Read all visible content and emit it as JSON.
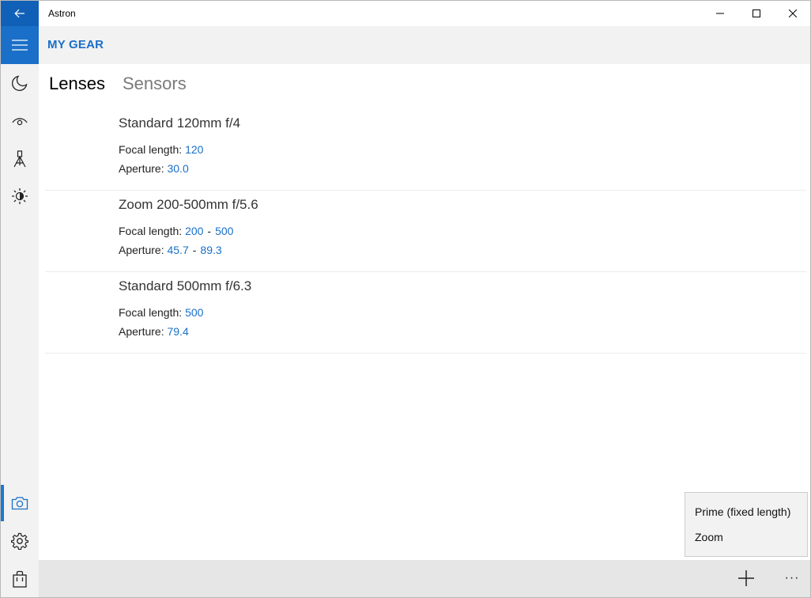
{
  "window": {
    "title": "Astron",
    "controls": {
      "minimize": "minimize-icon",
      "maximize": "maximize-icon",
      "close": "close-icon"
    },
    "back_icon": "back-arrow-icon"
  },
  "header": {
    "title": "MY GEAR"
  },
  "rail": {
    "items": [
      {
        "name": "moon-icon"
      },
      {
        "name": "eye-icon"
      },
      {
        "name": "telescope-icon"
      },
      {
        "name": "sun-icon"
      },
      {
        "name": "camera-icon",
        "active": true
      },
      {
        "name": "gear-icon"
      },
      {
        "name": "shopping-bag-icon"
      }
    ]
  },
  "tabs": [
    {
      "label": "Lenses",
      "selected": true
    },
    {
      "label": "Sensors",
      "selected": false
    }
  ],
  "lenses": [
    {
      "name": "Standard 120mm f/4",
      "focal_label": "Focal length:",
      "focal": [
        "120"
      ],
      "aperture_label": "Aperture:",
      "aperture": [
        "30.0"
      ]
    },
    {
      "name": "Zoom 200-500mm f/5.6",
      "focal_label": "Focal length:",
      "focal": [
        "200",
        "500"
      ],
      "focal_sep": "-",
      "aperture_label": "Aperture:",
      "aperture": [
        "45.7",
        "89.3"
      ],
      "aperture_sep": "-"
    },
    {
      "name": "Standard 500mm f/6.3",
      "focal_label": "Focal length:",
      "focal": [
        "500"
      ],
      "aperture_label": "Aperture:",
      "aperture": [
        "79.4"
      ]
    }
  ],
  "popup_menu": {
    "items": [
      "Prime (fixed length)",
      "Zoom"
    ]
  },
  "bottombar": {
    "add_icon": "plus-icon",
    "more_label": "···"
  },
  "colors": {
    "accent": "#1a6fc8",
    "back_button": "#1160b8",
    "rail_bg": "#f2f2f2",
    "bottombar_bg": "#e6e6e6"
  }
}
